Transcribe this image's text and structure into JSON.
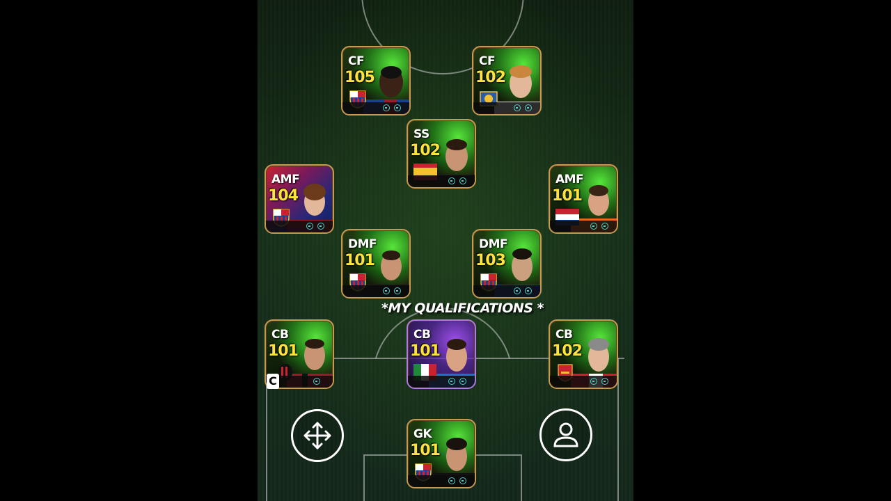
{
  "caption": "*MY QUALIFICATIONS *",
  "captain_badge": "C",
  "colors": {
    "card_border": "#c79a52",
    "rating": "#ffe23a",
    "glow_green": "#5af03c",
    "highlight_purple": "#b07be0"
  },
  "players": [
    {
      "id": "cf-left",
      "position": "CF",
      "rating": "105",
      "crest": "barcelona-crest-icon"
    },
    {
      "id": "cf-right",
      "position": "CF",
      "rating": "102",
      "crest": "club-crest-icon"
    },
    {
      "id": "ss",
      "position": "SS",
      "rating": "102",
      "crest": "spain-flag-icon"
    },
    {
      "id": "amf-left",
      "position": "AMF",
      "rating": "104",
      "crest": "barcelona-crest-icon"
    },
    {
      "id": "amf-right",
      "position": "AMF",
      "rating": "101",
      "crest": "netherlands-flag-icon"
    },
    {
      "id": "dmf-left",
      "position": "DMF",
      "rating": "101",
      "crest": "barcelona-crest-icon"
    },
    {
      "id": "dmf-right",
      "position": "DMF",
      "rating": "103",
      "crest": "barcelona-crest-icon"
    },
    {
      "id": "cb-left",
      "position": "CB",
      "rating": "101",
      "crest": "ac-milan-crest-icon"
    },
    {
      "id": "cb-center",
      "position": "CB",
      "rating": "101",
      "crest": "italy-flag-icon"
    },
    {
      "id": "cb-right",
      "position": "CB",
      "rating": "102",
      "crest": "arsenal-crest-icon"
    },
    {
      "id": "gk",
      "position": "GK",
      "rating": "101",
      "crest": "barcelona-crest-icon"
    }
  ],
  "controls": {
    "move_icon": "move-arrows-icon",
    "player_icon": "user-profile-icon"
  }
}
